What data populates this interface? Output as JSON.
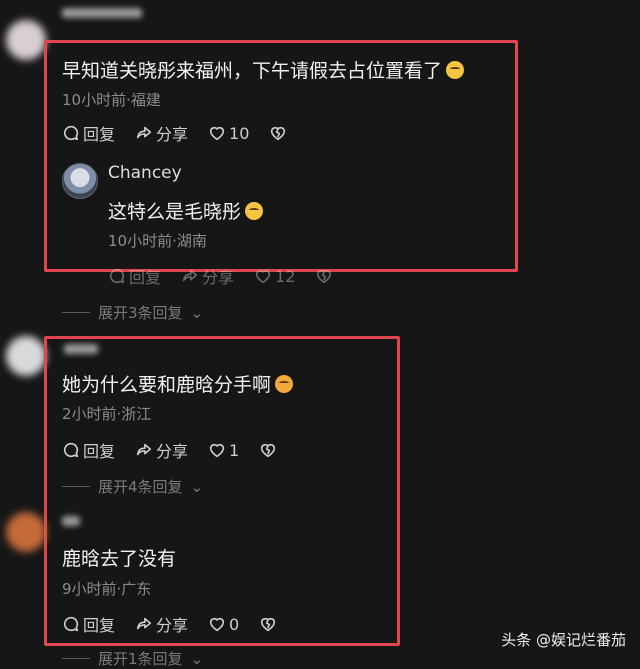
{
  "comments": [
    {
      "text": "早知道关晓彤来福州，下午请假去占位置看了",
      "meta": "10小时前·福建",
      "reply_label": "回复",
      "share_label": "分享",
      "likes": "10",
      "replies": [
        {
          "author": "Chancey",
          "text": "这特么是毛晓彤",
          "meta": "10小时前·湖南",
          "reply_label": "回复",
          "share_label": "分享",
          "likes": "12"
        }
      ],
      "expand_label": "展开3条回复"
    },
    {
      "text": "她为什么要和鹿晗分手啊",
      "meta": "2小时前·浙江",
      "reply_label": "回复",
      "share_label": "分享",
      "likes": "1",
      "expand_label": "展开4条回复"
    },
    {
      "text": "鹿晗去了没有",
      "meta": "9小时前·广东",
      "reply_label": "回复",
      "share_label": "分享",
      "likes": "0",
      "expand_label": "展开1条回复"
    }
  ],
  "watermark": "头条 @娱记烂番茄",
  "colors": {
    "highlight_box": "#e0464d",
    "background": "#161616"
  }
}
